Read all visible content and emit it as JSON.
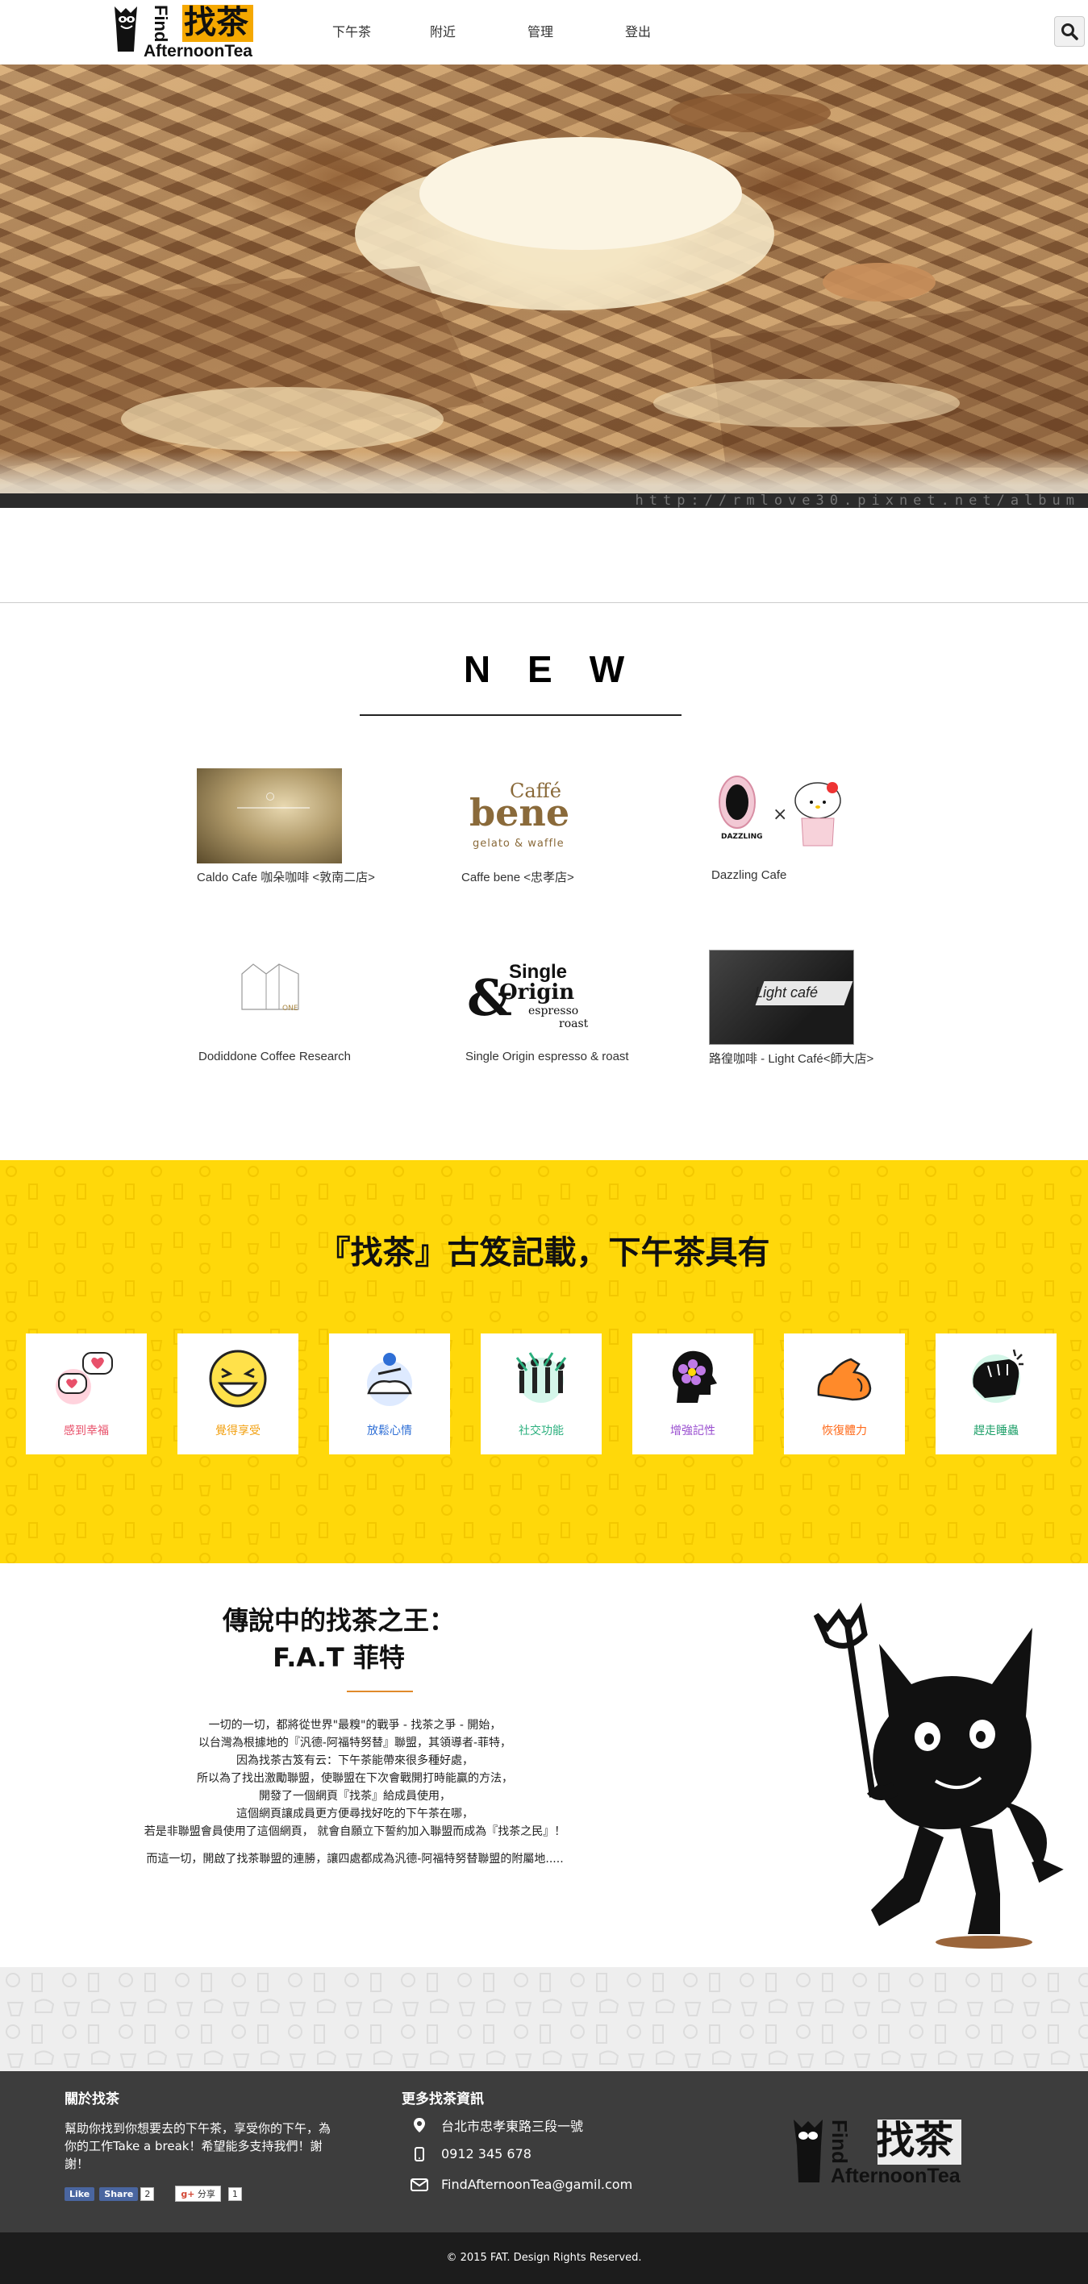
{
  "brand": {
    "logo_find": "Find",
    "logo_zh": "找茶",
    "logo_en": "AfternoonTea"
  },
  "nav": {
    "items": [
      "下午茶",
      "附近",
      "管理",
      "登出"
    ]
  },
  "hero": {
    "watermark": "http://rmlove30.pixnet.net/album"
  },
  "new_section": {
    "title": "NEW",
    "shops": [
      {
        "name": "Caldo Cafe 咖朵咖啡 <敦南二店>"
      },
      {
        "name": "Caffe bene <忠孝店>",
        "logo_line1": "Caffé",
        "logo_line2": "bene",
        "logo_line3": "gelato & waffle"
      },
      {
        "name": "Dazzling Cafe",
        "logo_text": "DAZZLING"
      },
      {
        "name": "Dodiddone Coffee Research",
        "logo_text": "ONE"
      },
      {
        "name": "Single Origin espresso & roast",
        "logo_line1": "Single",
        "logo_line2": "Origin",
        "logo_line3": "espresso",
        "logo_line4": "roast"
      },
      {
        "name": "路徨咖啡 - Light Café<師大店>",
        "logo_text": "Light café"
      }
    ]
  },
  "benefits": {
    "title": "『找茶』古笈記載，下午茶具有",
    "items": [
      {
        "label": "感到幸福",
        "color": "#e8506a"
      },
      {
        "label": "覺得享受",
        "color": "#f2a010"
      },
      {
        "label": "放鬆心情",
        "color": "#2f6fd6"
      },
      {
        "label": "社交功能",
        "color": "#2bb07e"
      },
      {
        "label": "增強記性",
        "color": "#9a4fd0"
      },
      {
        "label": "恢復體力",
        "color": "#ff6a1a"
      },
      {
        "label": "趕走睡蟲",
        "color": "#1fa06a"
      }
    ]
  },
  "king": {
    "title_line1": "傳說中的找茶之王：",
    "title_line2": "F.A.T 菲特",
    "paragraph_lines": [
      "一切的一切，都將從世界\"最糗\"的戰爭 - 找茶之爭 - 開始，",
      "以台灣為根據地的『汎德-阿福特努替』聯盟，其領導者-菲特，",
      "因為找茶古笈有云：下午茶能帶來很多種好處，",
      "所以為了找出激勵聯盟，使聯盟在下次會戰開打時能贏的方法，",
      "開發了一個網頁『找茶』給成員使用，",
      "這個網頁讓成員更方便尋找好吃的下午茶在哪，",
      "若是非聯盟會員使用了這個網頁，  就會自願立下誓約加入聯盟而成為『找茶之民』！"
    ],
    "closing": "而這一切，開啟了找茶聯盟的連勝，讓四處都成為汎德-阿福特努替聯盟的附屬地....."
  },
  "footer": {
    "about_title": "關於找茶",
    "about_text": "幫助你找到你想要去的下午茶，享受你的下午，為你的工作Take a break！希望能多支持我們！謝謝！",
    "fb_like": "Like",
    "fb_share": "Share",
    "fb_count": "2",
    "gplus_label": "分享",
    "gplus_count": "1",
    "more_title": "更多找茶資訊",
    "address": "台北市忠孝東路三段一號",
    "phone": "0912 345 678",
    "email": "FindAfternoonTea@gamil.com",
    "copyright": "© 2015 FAT. Design Rights Reserved."
  }
}
